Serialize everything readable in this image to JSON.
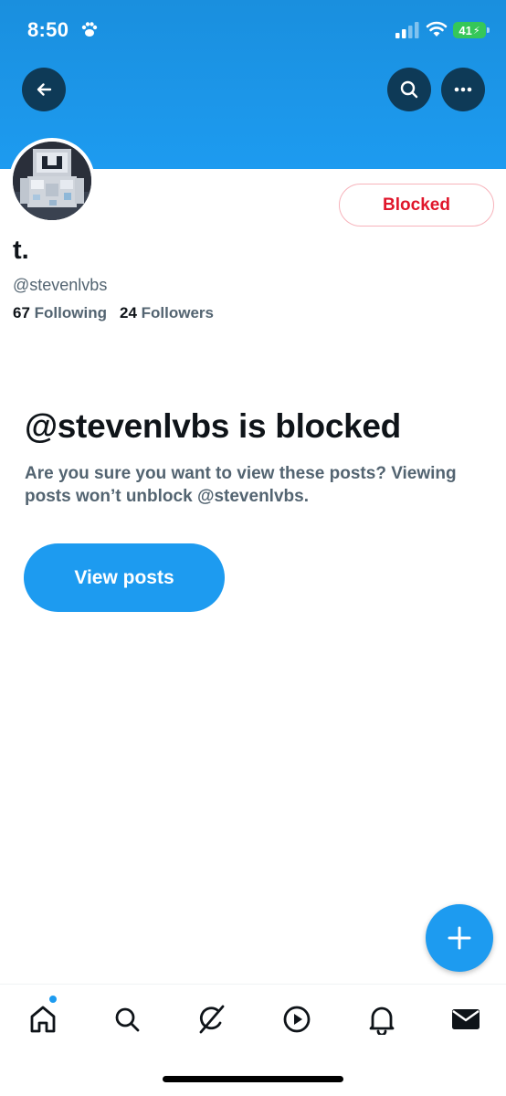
{
  "status_bar": {
    "time": "8:50",
    "battery": "41"
  },
  "profile": {
    "display_name": "t.",
    "handle": "@stevenlvbs",
    "following_count": "67",
    "following_label": "Following",
    "followers_count": "24",
    "followers_label": "Followers",
    "blocked_button_label": "Blocked"
  },
  "blocked_notice": {
    "title": "@stevenlvbs is blocked",
    "description": "Are you sure you want to view these posts? Viewing posts won’t unblock @stevenlvbs.",
    "view_posts_label": "View posts"
  },
  "icons": {
    "back": "arrow-left-icon",
    "search": "search-icon",
    "more": "more-horizontal-icon",
    "compose": "plus-icon",
    "tabs": [
      "home-icon",
      "search-icon",
      "grok-icon",
      "video-icon",
      "bell-icon",
      "envelope-icon"
    ]
  },
  "colors": {
    "accent": "#1d9bf0",
    "blocked_red": "#e0162b",
    "secondary_text": "#536471"
  }
}
